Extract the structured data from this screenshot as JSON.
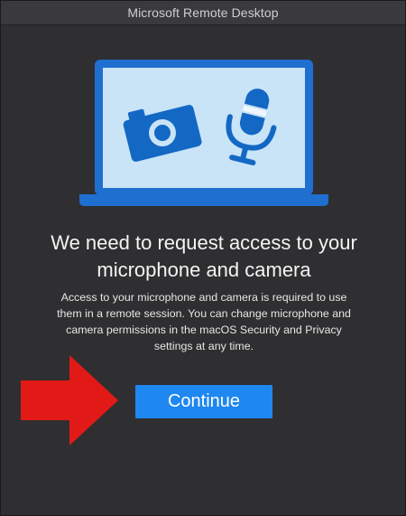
{
  "window": {
    "title": "Microsoft Remote Desktop"
  },
  "illustration": {
    "icons": [
      "laptop-icon",
      "camera-icon",
      "microphone-icon"
    ],
    "colors": {
      "laptop_frame": "#1e6fd0",
      "laptop_screen": "#c9e3f7",
      "icon_blue": "#1368c4"
    }
  },
  "dialog": {
    "heading": "We need to request access to your microphone and camera",
    "body": "Access to your microphone and camera is required to use them in a remote session. You can change microphone and camera permissions in the macOS Security and Privacy settings at any time.",
    "continue_label": "Continue"
  },
  "annotation": {
    "icon": "red-arrow-icon",
    "color": "#e11a17"
  },
  "colors": {
    "background": "#2f2f31",
    "titlebar": "#3a3a3c",
    "accent": "#1e87f0"
  }
}
